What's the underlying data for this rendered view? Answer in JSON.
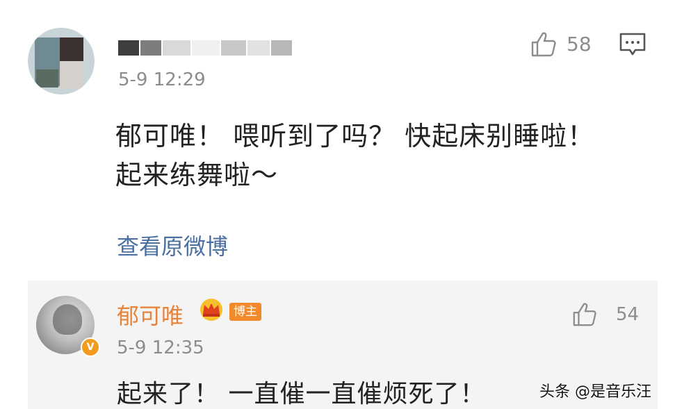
{
  "top_comment": {
    "timestamp": "5-9 12:29",
    "like_count": "58",
    "lines": [
      "郁可唯！ 喂听到了吗？ 快起床别睡啦！",
      "起来练舞啦～"
    ],
    "view_original_label": "查看原微博"
  },
  "reply": {
    "name": "郁可唯",
    "badge_label": "博主",
    "timestamp": "5-9 12:35",
    "like_count": "54",
    "text": "起来了！ 一直催一直催烦死了！"
  },
  "watermark": "头条 @是音乐汪",
  "icons": {
    "like": "thumbs-up-icon",
    "comment": "comment-bubble-icon",
    "crown": "crown-icon",
    "verified": "verified-badge-icon"
  },
  "colors": {
    "name_orange": "#e8833a",
    "link_blue": "#4a6fa0",
    "muted_gray": "#8c8c8c",
    "panel_bg": "#f4f4f4"
  }
}
